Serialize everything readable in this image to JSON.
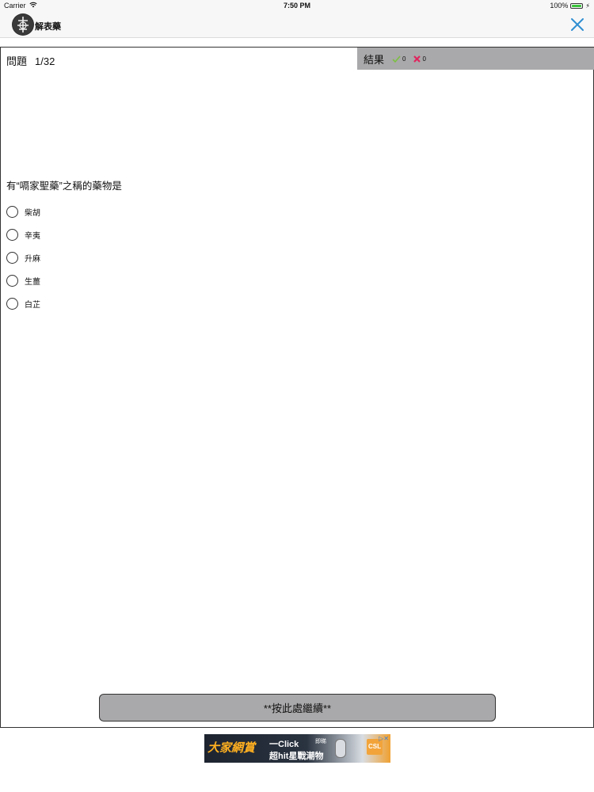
{
  "status_bar": {
    "carrier": "Carrier",
    "time": "7:50 PM",
    "battery_percent": "100%",
    "battery_level": 1.0,
    "icons": [
      "wifi-icon",
      "battery-icon",
      "charging-icon"
    ]
  },
  "nav": {
    "title": "解表藥",
    "close_icon": "close-icon",
    "accent": "#2f8fd1"
  },
  "quiz": {
    "label": "問題",
    "progress": "1/32",
    "result_label": "結果",
    "correct_count": "0",
    "wrong_count": "0",
    "correct_color": "#7cc142",
    "wrong_color": "#e0245e",
    "question": "有“嗝家聖藥”之稱的藥物是",
    "options": [
      {
        "label": "柴胡"
      },
      {
        "label": "辛夷"
      },
      {
        "label": "升麻"
      },
      {
        "label": "生薑"
      },
      {
        "label": "白芷"
      }
    ],
    "continue_label": "**按此處繼續**"
  },
  "ad": {
    "brand": "大家網賞",
    "line1": "一Click",
    "line2": "超hit星戰潮物",
    "tag": "即睇",
    "sponsor": "CSL",
    "close": "▷✕"
  }
}
